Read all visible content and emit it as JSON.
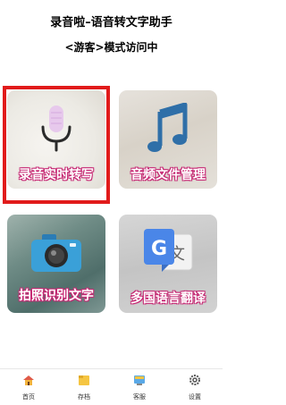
{
  "header": {
    "title": "录音啦–语音转文字助手",
    "mode": "<游客>模式访问中"
  },
  "tiles": [
    {
      "label": "录音实时转写",
      "icon": "microphone-icon",
      "selected": true
    },
    {
      "label": "音频文件管理",
      "icon": "music-note-icon",
      "selected": false
    },
    {
      "label": "拍照识别文字",
      "icon": "camera-icon",
      "selected": false
    },
    {
      "label": "多国语言翻译",
      "icon": "google-translate-icon",
      "selected": false
    }
  ],
  "nav": [
    {
      "label": "首页",
      "icon": "home-icon"
    },
    {
      "label": "存档",
      "icon": "archive-icon"
    },
    {
      "label": "客服",
      "icon": "customer-service-icon"
    },
    {
      "label": "设置",
      "icon": "gear-icon"
    }
  ],
  "colors": {
    "label_outline": "#c62873",
    "selection_border": "#e11b1b",
    "note_blue": "#2f6fa8",
    "camera_blue": "#3aa0d8",
    "translate_blue": "#4a86e8"
  }
}
